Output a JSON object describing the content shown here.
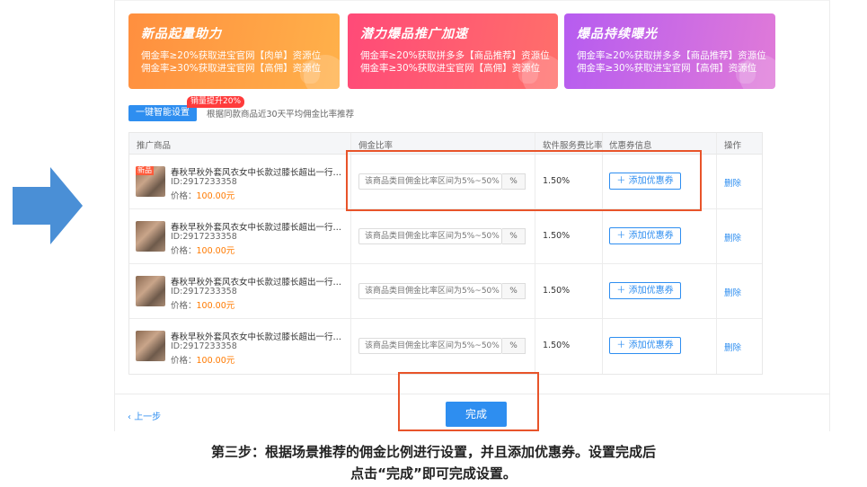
{
  "cards": [
    {
      "title": "新品起量助力",
      "lines": [
        "佣金率≥20%获取进宝官网【肉单】资源位",
        "佣金率≥30%获取进宝官网【高佣】资源位"
      ],
      "color": "#ff9b42"
    },
    {
      "title": "潜力爆品推广加速",
      "lines": [
        "佣金率≥20%获取拼多多【商品推荐】资源位",
        "佣金率≥30%获取进宝官网【高佣】资源位"
      ],
      "color": "#ff5273"
    },
    {
      "title": "爆品持续曝光",
      "lines": [
        "佣金率≥20%获取拼多多【商品推荐】资源位",
        "佣金率≥30%获取进宝官网【高佣】资源位"
      ],
      "color": "#c163ea"
    }
  ],
  "smart_setting": {
    "button_label": "一键智能设置",
    "badge": "销量提升20%",
    "hint": "根据同款商品近30天平均佣金比率推荐"
  },
  "table": {
    "headers": {
      "product": "推广商品",
      "rate": "佣金比率",
      "fee": "软件服务费比率",
      "coupon": "优惠券信息",
      "action": "操作"
    },
    "rows": [
      {
        "new_tag": "新品",
        "name": "春秋早秋外套风衣女中长款过膝长超出一行就打点…",
        "id": "ID:2917233358",
        "price_label": "价格：",
        "price": "100.00元",
        "rate_placeholder": "该商品类目佣金比率区间为5%~50%",
        "rate_unit": "%",
        "fee": "1.50%",
        "coupon_label": "添加优惠券",
        "action": "删除"
      },
      {
        "new_tag": "",
        "name": "春秋早秋外套风衣女中长款过膝长超出一行就打点…",
        "id": "ID:2917233358",
        "price_label": "价格：",
        "price": "100.00元",
        "rate_placeholder": "该商品类目佣金比率区间为5%~50%",
        "rate_unit": "%",
        "fee": "1.50%",
        "coupon_label": "添加优惠券",
        "action": "删除"
      },
      {
        "new_tag": "",
        "name": "春秋早秋外套风衣女中长款过膝长超出一行就打点…",
        "id": "ID:2917233358",
        "price_label": "价格：",
        "price": "100.00元",
        "rate_placeholder": "该商品类目佣金比率区间为5%~50%",
        "rate_unit": "%",
        "fee": "1.50%",
        "coupon_label": "添加优惠券",
        "action": "删除"
      },
      {
        "new_tag": "",
        "name": "春秋早秋外套风衣女中长款过膝长超出一行就打点…",
        "id": "ID:2917233358",
        "price_label": "价格：",
        "price": "100.00元",
        "rate_placeholder": "该商品类目佣金比率区间为5%~50%",
        "rate_unit": "%",
        "fee": "1.50%",
        "coupon_label": "添加优惠券",
        "action": "删除"
      }
    ]
  },
  "footer": {
    "prev_label": "上一步",
    "done_label": "完成"
  },
  "caption": {
    "line1": "第三步：根据场景推荐的佣金比例进行设置，并且添加优惠券。设置完成后",
    "line2": "点击“完成”即可完成设置。"
  },
  "colors": {
    "primary": "#2e8ef0",
    "highlight": "#e8542a",
    "price": "#ff7a00",
    "arrow": "#4a8fd6"
  },
  "icons": {
    "arrow": "right-arrow-icon",
    "plus": "plus-icon",
    "back": "chevron-left-icon"
  }
}
